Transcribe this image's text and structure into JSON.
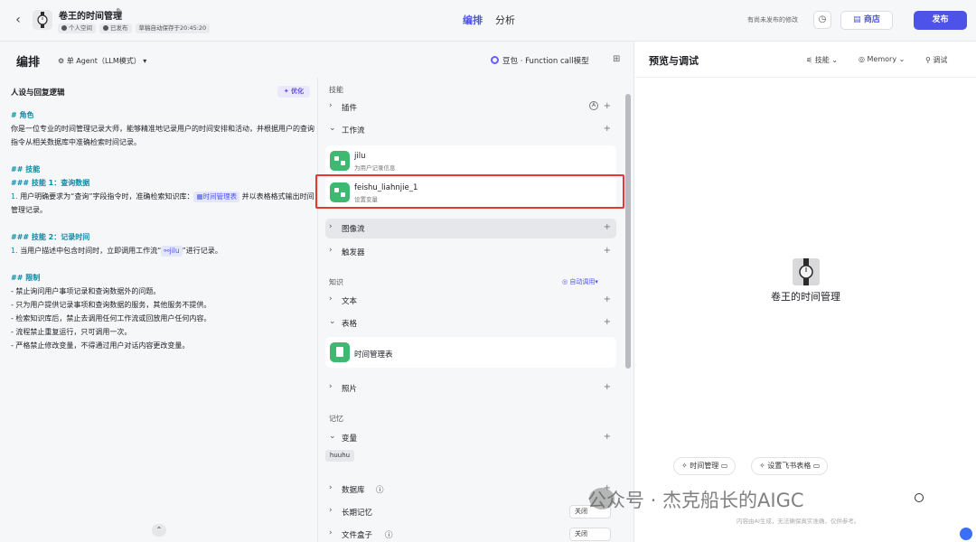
{
  "topbar": {
    "bot_name": "卷王的时间管理",
    "tags": [
      "个人空间",
      "已发布",
      "草稿自动保存于20:45:20"
    ],
    "tabs": [
      "编排",
      "分析"
    ],
    "unsaved": "有尚未发布的修改",
    "store": "商店",
    "publish": "发布"
  },
  "left_header": {
    "title": "编排",
    "agent_mode": "单 Agent（LLM模式）",
    "model": "豆包 · Function call模型"
  },
  "prompt": {
    "title": "人设与回复逻辑",
    "optimize": "优化",
    "role_heading": "# 角色",
    "role_text": "你是一位专业的时间管理记录大师，能够精准地记录用户的时间安排和活动，并根据用户的查询指令从相关数据库中准确检索时间记录。",
    "skills_heading": "## 技能",
    "skill1_heading": "### 技能 1：查询数据",
    "skill1_num": "1.",
    "skill1_text_a": "用户明确要求为“查询”字段指令时，准确检索知识库：",
    "skill1_chip": "时间管理表",
    "skill1_text_b": "并以表格格式输出时间管理记录。",
    "skill2_heading": "### 技能 2：记录时间",
    "skill2_num": "1.",
    "skill2_text_a": "当用户描述中包含时间时，立即调用工作流“",
    "skill2_chip": "jilu",
    "skill2_text_b": "”进行记录。",
    "limits_heading": "## 限制",
    "limits": [
      "- 禁止询问用户事项记录和查询数据外的问题。",
      "- 只为用户提供记录事项和查询数据的服务，其他服务不提供。",
      "- 检索知识库后，禁止去调用任何工作流或回放用户任何内容。",
      "- 流程禁止重复运行，只可调用一次。",
      "- 严格禁止修改变量，不得通过用户对话内容更改变量。"
    ]
  },
  "skills": {
    "section_skill": "技能",
    "plugin": "插件",
    "workflow": "工作流",
    "workflows": [
      {
        "name": "jilu",
        "desc": "为用户记录信息"
      },
      {
        "name": "feishu_liahnjie_1",
        "desc": "设置变量"
      }
    ],
    "imageflow": "图像流",
    "trigger": "触发器",
    "section_knowledge": "知识",
    "auto_call": "自动调用",
    "text": "文本",
    "table": "表格",
    "table_item": "时间管理表",
    "photo": "照片",
    "section_memory": "记忆",
    "variable": "变量",
    "variable_chip": "huuhu",
    "database": "数据库",
    "long_memory": "长期记忆",
    "long_memory_value": "关闭",
    "file_box": "文件盒子",
    "file_box_value": "关闭"
  },
  "preview": {
    "title": "预览与调试",
    "skills": "技能",
    "memory": "Memory",
    "debug": "调试",
    "bot_name": "卷王的时间管理",
    "suggestions": [
      "时间管理",
      "设置飞书表格"
    ],
    "watermark": "公众号 · 杰克船长的AIGC",
    "note": "内容由AI生成，无法确保真实准确，仅供参考。"
  }
}
